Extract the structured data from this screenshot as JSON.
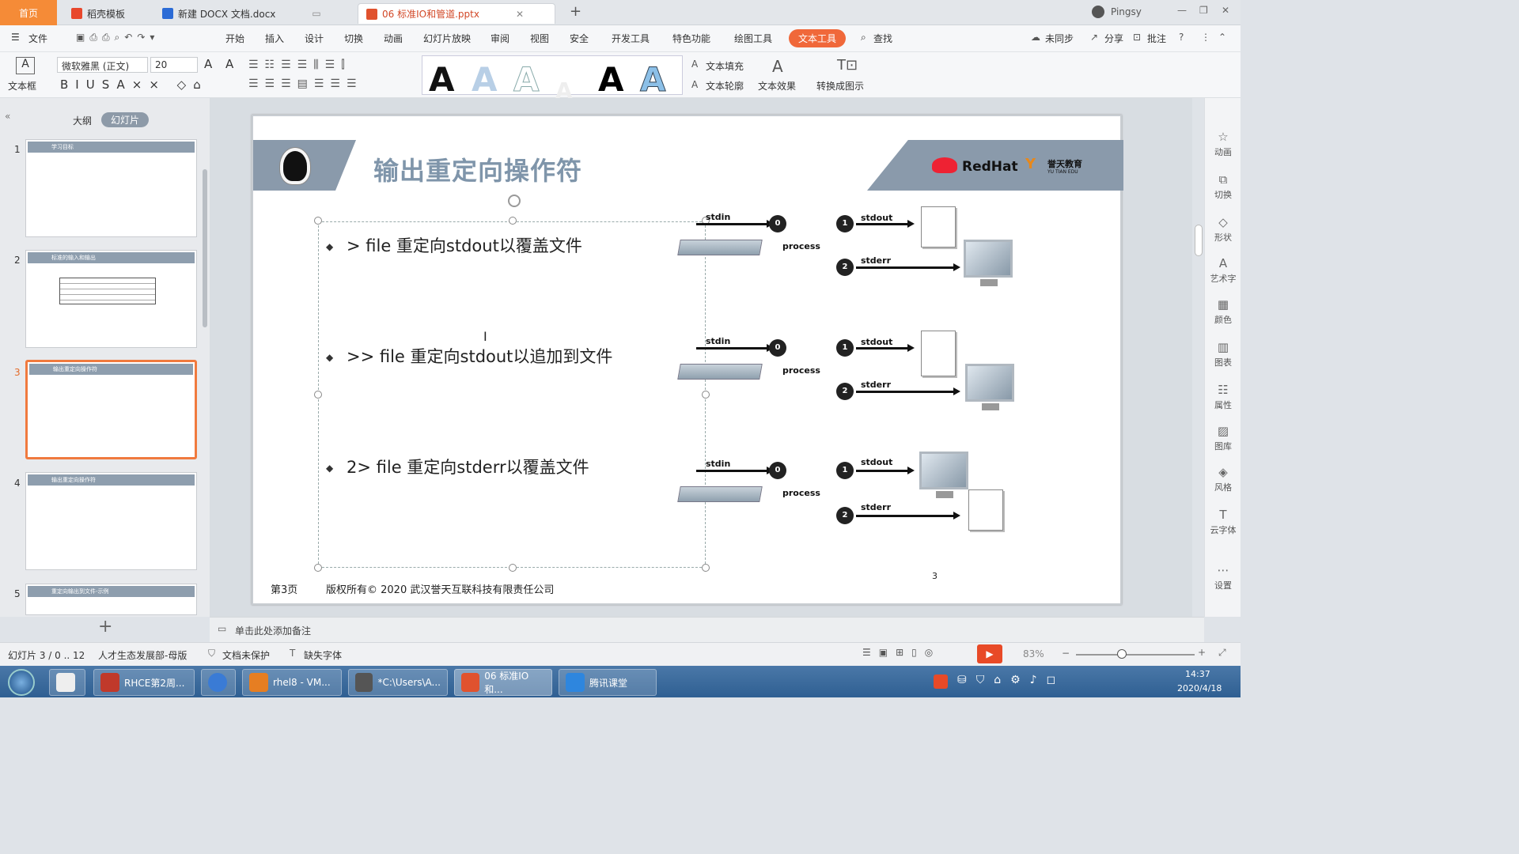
{
  "titlebar": {
    "home_tab": "首页",
    "tabs": [
      {
        "label": "稻壳模板"
      },
      {
        "label": "新建 DOCX 文档.docx"
      },
      {
        "label": "06 标准IO和管道.pptx"
      }
    ],
    "user": "Pingsy"
  },
  "menubar": {
    "file": "文件",
    "items": [
      "开始",
      "插入",
      "设计",
      "切换",
      "动画",
      "幻灯片放映",
      "审阅",
      "视图",
      "安全",
      "开发工具",
      "特色功能",
      "绘图工具",
      "文本工具"
    ],
    "search": "查找",
    "sync": "未同步",
    "share": "分享",
    "annotate": "批注"
  },
  "ribbon": {
    "textbox": "文本框",
    "font_name": "微软雅黑 (正文)",
    "font_size": "20",
    "text_fill": "文本填充",
    "text_outline": "文本轮廓",
    "text_effect": "文本效果",
    "convert": "转换成图示"
  },
  "leftpanel": {
    "tab_outline": "大纲",
    "tab_slides": "幻灯片",
    "thumbs": [
      {
        "num": "1",
        "title": "学习目标"
      },
      {
        "num": "2",
        "title": "标准的输入和输出"
      },
      {
        "num": "3",
        "title": "输出重定向操作符"
      },
      {
        "num": "4",
        "title": "输出重定向操作符"
      },
      {
        "num": "5",
        "title": "重定向输出到文件-示例"
      }
    ]
  },
  "slide": {
    "title": "输出重定向操作符",
    "logo_redhat": "RedHat",
    "logo_edu": "誉天教育",
    "logo_edu_en": "YU TIAN EDU",
    "bullets": [
      "> file 重定向stdout以覆盖文件",
      ">> file 重定向stdout以追加到文件",
      "2> file 重定向stderr以覆盖文件"
    ],
    "diagram": {
      "stdin": "stdin",
      "stdout": "stdout",
      "stderr": "stderr",
      "process": "process",
      "n0": "0",
      "n1": "1",
      "n2": "2"
    },
    "footer_page": "第3页",
    "footer_copyright": "版权所有© 2020 武汉誉天互联科技有限责任公司",
    "page_number": "3"
  },
  "rightpanel": [
    "动画",
    "切换",
    "形状",
    "艺术字",
    "颜色",
    "图表",
    "属性",
    "图库",
    "风格",
    "云字体",
    "设置"
  ],
  "notes": "单击此处添加备注",
  "statusbar": {
    "slide_info": "幻灯片 3 / 0 .. 12",
    "template": "人才生态发展部-母版",
    "protect": "文档未保护",
    "font_missing": "缺失字体",
    "zoom": "83%"
  },
  "taskbar": {
    "items": [
      "RHCE第2周...",
      "rhel8 - VM...",
      "*C:\\Users\\A...",
      "06 标准IO和...",
      "腾讯课堂"
    ],
    "time": "14:37",
    "date": "2020/4/18"
  }
}
